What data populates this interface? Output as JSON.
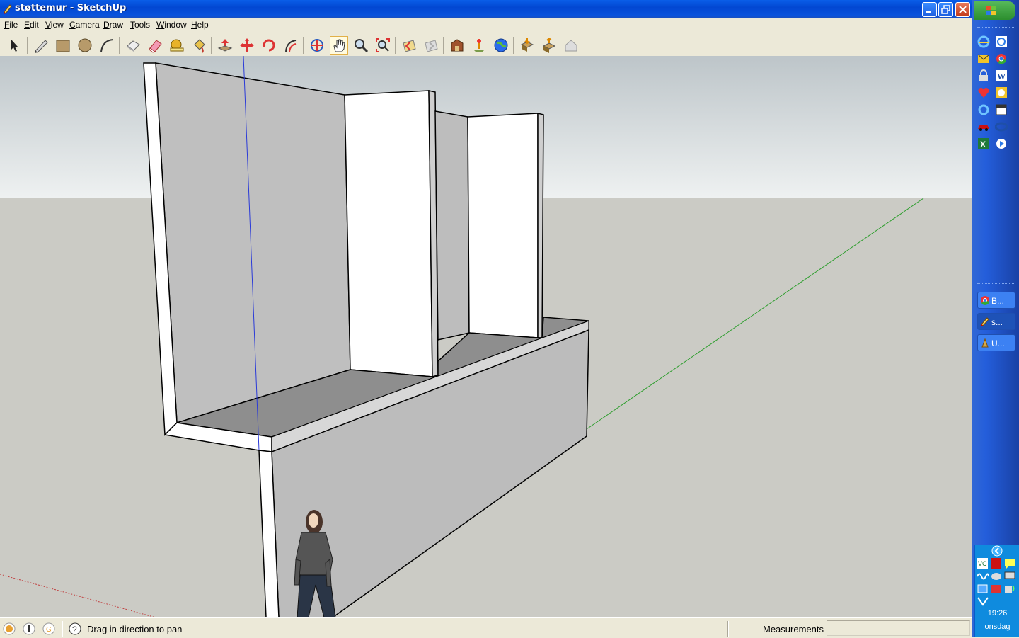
{
  "window": {
    "title": "støttemur - SketchUp"
  },
  "menu": [
    {
      "label": "File",
      "u": "F",
      "rest": "ile"
    },
    {
      "label": "Edit",
      "u": "E",
      "rest": "dit"
    },
    {
      "label": "View",
      "u": "V",
      "rest": "iew"
    },
    {
      "label": "Camera",
      "u": "C",
      "rest": "amera"
    },
    {
      "label": "Draw",
      "u": "D",
      "rest": "raw"
    },
    {
      "label": "Tools",
      "u": "T",
      "rest": "ools"
    },
    {
      "label": "Window",
      "u": "W",
      "rest": "indow"
    },
    {
      "label": "Help",
      "u": "H",
      "rest": "elp"
    }
  ],
  "toolbar": {
    "tools": [
      "select-tool",
      "pencil-tool",
      "rectangle-tool",
      "circle-tool",
      "arc-tool",
      "make-component-tool",
      "eraser-tool",
      "tape-measure-tool",
      "paint-bucket-tool",
      "push-pull-tool",
      "move-tool",
      "rotate-tool",
      "offset-tool",
      "orbit-tool",
      "pan-tool",
      "zoom-tool",
      "zoom-extents-tool",
      "previous-view-tool",
      "next-view-tool",
      "get-models-tool",
      "add-location-tool",
      "google-earth-tool",
      "get-components-tool",
      "share-component-tool",
      "share-model-tool"
    ],
    "active_tool": "pan-tool"
  },
  "status": {
    "hint": "Drag in direction to pan",
    "measurements_label": "Measurements",
    "measurements_value": ""
  },
  "taskbar": {
    "tasks": [
      {
        "label": "B...",
        "icon": "chrome-icon"
      },
      {
        "label": "s...",
        "icon": "sketchup-icon"
      },
      {
        "label": "U...",
        "icon": "app-icon"
      }
    ],
    "clock_time": "19:26",
    "clock_day": "onsdag"
  }
}
